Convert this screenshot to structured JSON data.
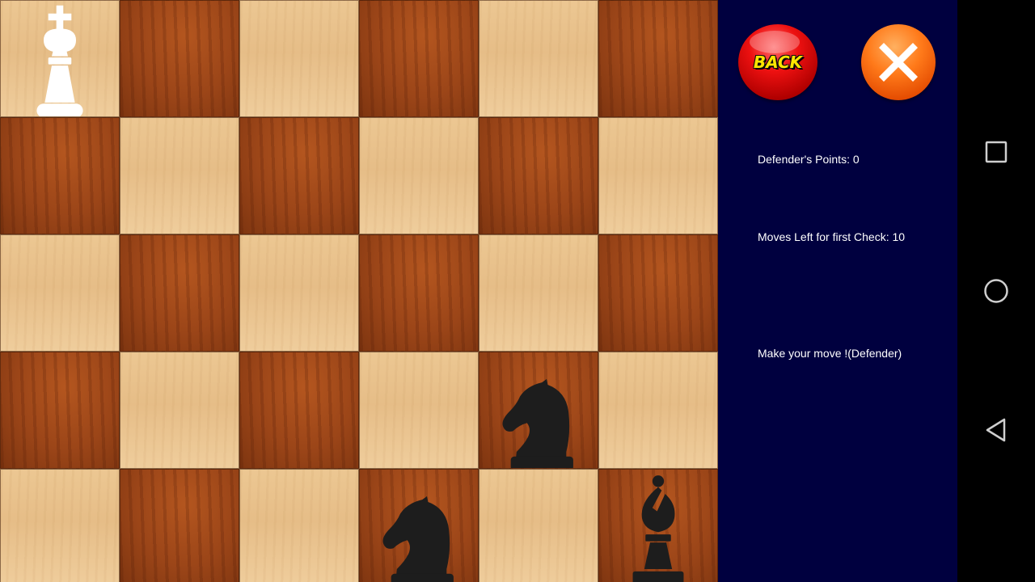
{
  "board": {
    "rows": 5,
    "cols": 6,
    "top_left_color": "light",
    "colors": {
      "light": "#e8c08a",
      "dark": "#9c4617"
    },
    "pieces": [
      {
        "row": 0,
        "col": 0,
        "type": "king",
        "color": "white"
      },
      {
        "row": 3,
        "col": 4,
        "type": "knight",
        "color": "black"
      },
      {
        "row": 4,
        "col": 3,
        "type": "knight",
        "color": "black"
      },
      {
        "row": 4,
        "col": 5,
        "type": "bishop",
        "color": "black"
      }
    ]
  },
  "panel": {
    "back_label": "BACK",
    "close_icon": "close-x-icon",
    "defender_points": "Defender's Points: 0",
    "moves_left": "Moves Left for first Check: 10",
    "status": "Make your move !(Defender)",
    "background": "#00003f"
  },
  "navbar": {
    "icons": [
      "recents-square-icon",
      "home-circle-icon",
      "back-triangle-icon"
    ]
  }
}
